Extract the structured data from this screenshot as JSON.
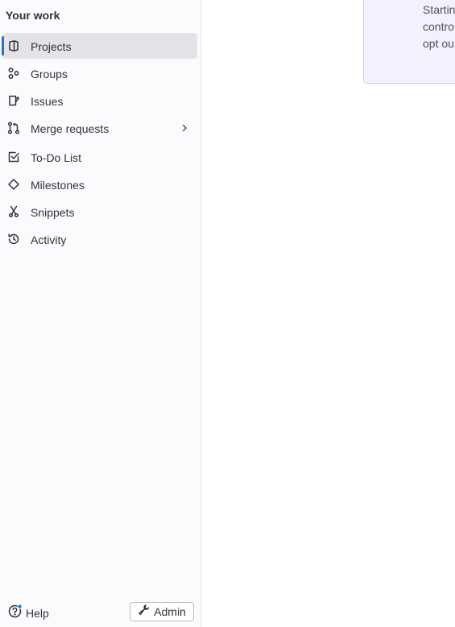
{
  "sidebar": {
    "section_title": "Your work",
    "items": [
      {
        "label": "Projects",
        "icon": "project-icon",
        "active": true
      },
      {
        "label": "Groups",
        "icon": "group-icon"
      },
      {
        "label": "Issues",
        "icon": "issues-icon"
      },
      {
        "label": "Merge requests",
        "icon": "merge-request-icon",
        "has_children": true
      },
      {
        "label": "To-Do List",
        "icon": "todo-icon"
      },
      {
        "label": "Milestones",
        "icon": "milestone-icon"
      },
      {
        "label": "Snippets",
        "icon": "snippet-icon"
      },
      {
        "label": "Activity",
        "icon": "history-icon"
      }
    ],
    "active_color": "#1f75cb"
  },
  "footer": {
    "help_label": "Help",
    "admin_label": "Admin"
  },
  "banner": {
    "lines": [
      "Startin",
      "contro",
      "opt ou"
    ],
    "background": "#f4f0ff"
  }
}
